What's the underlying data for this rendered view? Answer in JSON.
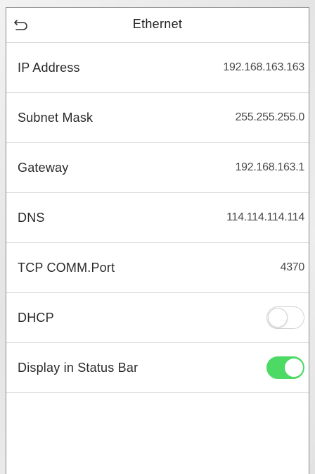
{
  "header": {
    "title": "Ethernet",
    "back_icon": "back-arrow-icon"
  },
  "rows": [
    {
      "label": "IP Address",
      "value": "192.168.163.163"
    },
    {
      "label": "Subnet Mask",
      "value": "255.255.255.0"
    },
    {
      "label": "Gateway",
      "value": "192.168.163.1"
    },
    {
      "label": "DNS",
      "value": "114.114.114.114"
    },
    {
      "label": "TCP COMM.Port",
      "value": "4370"
    }
  ],
  "toggles": [
    {
      "label": "DHCP",
      "state": "off"
    },
    {
      "label": "Display in Status Bar",
      "state": "on"
    }
  ],
  "colors": {
    "toggle_on": "#4cd964",
    "toggle_off_border": "#d4d4d4",
    "divider": "#dcdcdc",
    "text": "#2a2a2a"
  }
}
